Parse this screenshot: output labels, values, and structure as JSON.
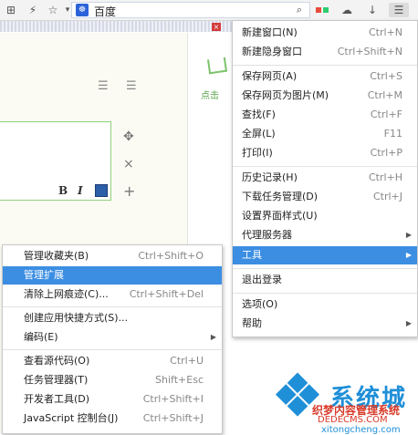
{
  "toolbar": {
    "address_text": "百度",
    "paw": "☸"
  },
  "editor": {
    "format_bold": "B",
    "format_italic": "I",
    "list_icon_1": "☰",
    "list_icon_2": "☰",
    "move": "✥",
    "close": "×",
    "add": "+",
    "green_hint": "点击"
  },
  "main_menu": {
    "items": [
      {
        "label": "新建窗口(N)",
        "shortcut": "Ctrl+N"
      },
      {
        "label": "新建隐身窗口",
        "shortcut": "Ctrl+Shift+N"
      },
      {
        "label": "保存网页(A)",
        "shortcut": "Ctrl+S"
      },
      {
        "label": "保存网页为图片(M)",
        "shortcut": "Ctrl+M"
      },
      {
        "label": "查找(F)",
        "shortcut": "Ctrl+F"
      },
      {
        "label": "全屏(L)",
        "shortcut": "F11"
      },
      {
        "label": "打印(I)",
        "shortcut": "Ctrl+P"
      },
      {
        "label": "历史记录(H)",
        "shortcut": "Ctrl+H"
      },
      {
        "label": "下载任务管理(D)",
        "shortcut": "Ctrl+J"
      },
      {
        "label": "设置界面样式(U)",
        "shortcut": ""
      },
      {
        "label": "代理服务器",
        "shortcut": ""
      },
      {
        "label": "工具",
        "shortcut": ""
      },
      {
        "label": "退出登录",
        "shortcut": ""
      },
      {
        "label": "选项(O)",
        "shortcut": ""
      },
      {
        "label": "帮助",
        "shortcut": ""
      }
    ]
  },
  "tools_menu": {
    "items": [
      {
        "label": "管理收藏夹(B)",
        "shortcut": "Ctrl+Shift+O"
      },
      {
        "label": "管理扩展",
        "shortcut": ""
      },
      {
        "label": "清除上网痕迹(C)...",
        "shortcut": "Ctrl+Shift+Del"
      },
      {
        "label": "创建应用快捷方式(S)...",
        "shortcut": ""
      },
      {
        "label": "编码(E)",
        "shortcut": ""
      },
      {
        "label": "查看源代码(O)",
        "shortcut": "Ctrl+U"
      },
      {
        "label": "任务管理器(T)",
        "shortcut": "Shift+Esc"
      },
      {
        "label": "开发者工具(D)",
        "shortcut": "Ctrl+Shift+I"
      },
      {
        "label": "JavaScript 控制台(J)",
        "shortcut": "Ctrl+Shift+J"
      }
    ]
  },
  "watermark": {
    "big": "系统城",
    "line1": "织梦内容管理系统",
    "line2": "DEDECMS.COM",
    "line3": "xitongcheng.com"
  },
  "colors": {
    "highlight": "#3c8ee2",
    "accent_blue": "#1f8fd8",
    "editor_border": "#8fcf7d"
  }
}
